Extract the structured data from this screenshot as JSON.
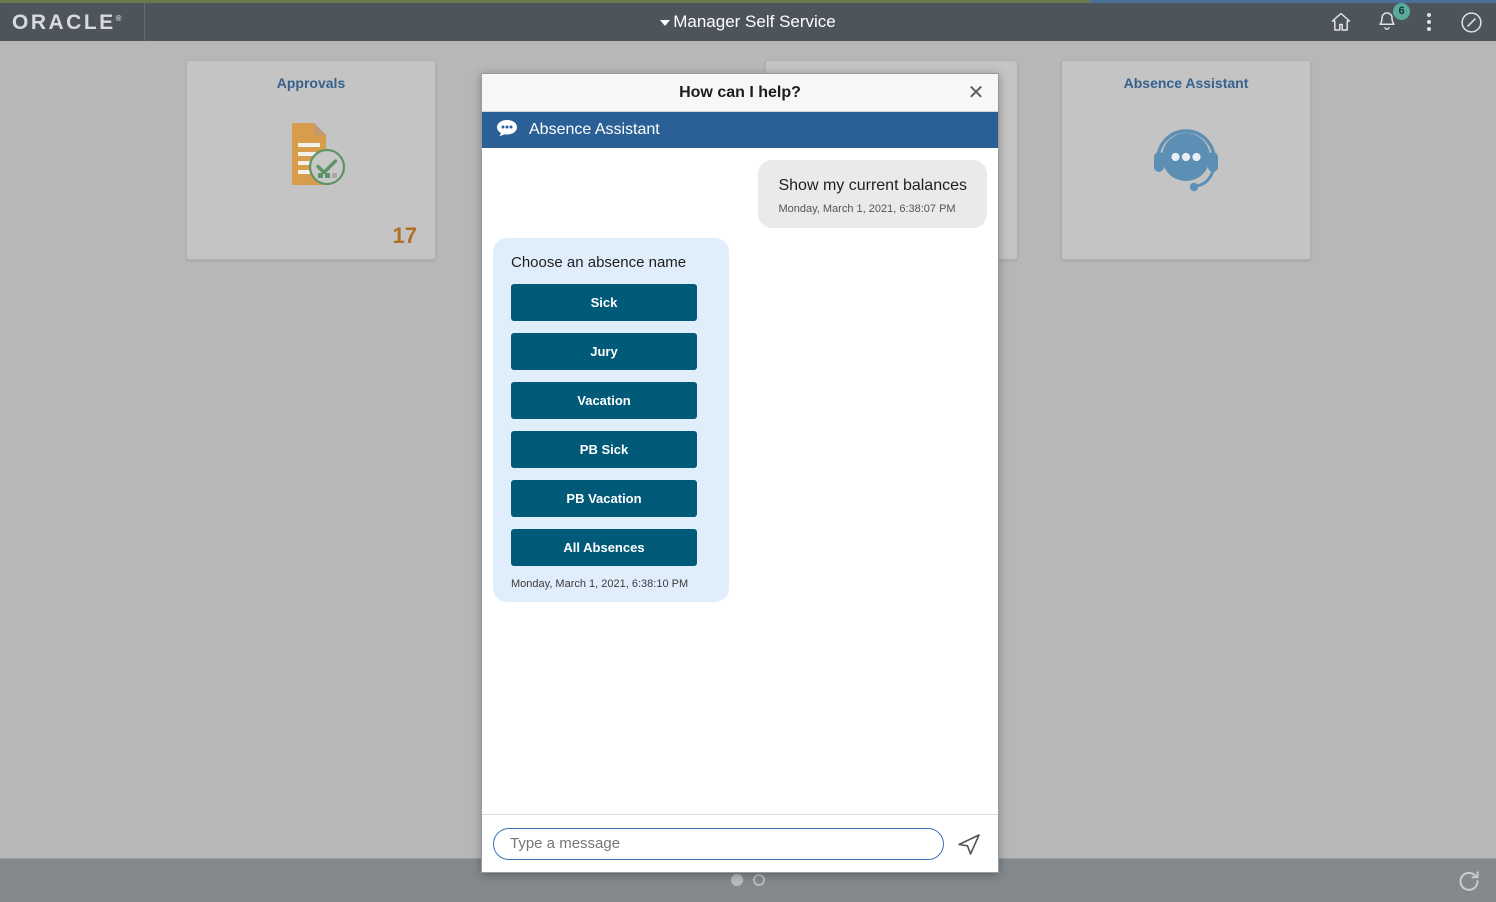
{
  "header": {
    "logo": "ORACLE",
    "title": "Manager Self Service",
    "icons": {
      "home": "home-icon",
      "notifications": "bell-icon",
      "notification_count": "6",
      "actions": "kebab-menu-icon",
      "navbar": "navbar-compass-icon"
    }
  },
  "tiles": [
    {
      "title": "Approvals",
      "count": "17",
      "icon": "document-approved-icon"
    },
    {
      "title": "",
      "count": "",
      "icon": ""
    },
    {
      "title": "Absence Assistant",
      "count": "",
      "icon": "headset-chat-icon"
    }
  ],
  "modal": {
    "title": "How can I help?",
    "close_label": "✕",
    "subheader": {
      "icon": "chat-bubble-icon",
      "label": "Absence Assistant"
    },
    "messages": [
      {
        "sender": "user",
        "text": "Show my current balances",
        "timestamp": "Monday, March 1, 2021, 6:38:07 PM"
      },
      {
        "sender": "bot",
        "prompt": "Choose an absence name",
        "choices": [
          "Sick",
          "Jury",
          "Vacation",
          "PB Sick",
          "PB Vacation",
          "All Absences"
        ],
        "timestamp": "Monday, March 1, 2021, 6:38:10 PM"
      }
    ],
    "input": {
      "value": "",
      "placeholder": "Type a message",
      "send_icon": "send-paper-plane-icon"
    }
  },
  "footer": {
    "pages": [
      "active",
      "inactive"
    ],
    "refresh_label": "refresh-icon"
  },
  "colors": {
    "header_bg": "#4d545c",
    "accent_blue": "#2a6095",
    "choice_button": "#005a78",
    "tile_bg": "#c4c4c4",
    "tile_title": "#36618e",
    "count_orange": "#b06f2a",
    "badge_green": "#5aa99a",
    "bot_bubble": "#e0eefb",
    "user_bubble": "#eaeaea"
  }
}
